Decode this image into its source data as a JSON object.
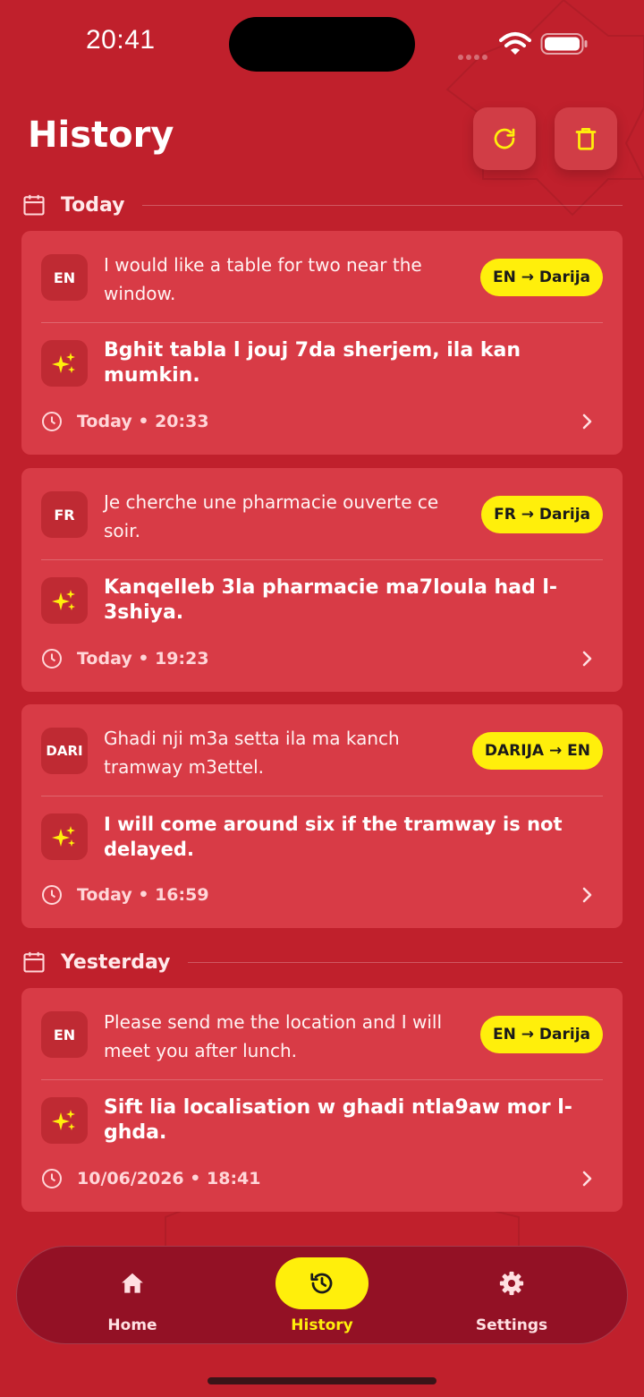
{
  "status_bar": {
    "time": "20:41"
  },
  "header": {
    "title": "History",
    "refresh_icon": "refresh-icon",
    "delete_icon": "trash-icon"
  },
  "sections": [
    {
      "label": "Today"
    },
    {
      "label": "Yesterday"
    }
  ],
  "entries": [
    {
      "src_lang": "EN",
      "source": "I would like a table for two near the window.",
      "direction": "EN → Darija",
      "translation": "Bghit tabla l jouj 7da sherjem, ila kan mumkin.",
      "time": "Today • 20:33"
    },
    {
      "src_lang": "FR",
      "source": "Je cherche une pharmacie ouverte ce soir.",
      "direction": "FR → Darija",
      "translation": "Kanqelleb 3la pharmacie ma7loula had l-3shiya.",
      "time": "Today • 19:23"
    },
    {
      "src_lang": "DARI",
      "source": "Ghadi nji m3a setta ila ma kanch tramway m3ettel.",
      "direction": "DARIJA → EN",
      "translation": "I will come around six if the tramway is not delayed.",
      "time": "Today • 16:59"
    },
    {
      "src_lang": "EN",
      "source": "Please send me the location and I will meet you after lunch.",
      "direction": "EN → Darija",
      "translation": "Sift lia localisation w ghadi ntla9aw mor l-ghda.",
      "time": "10/06/2026 • 18:41"
    }
  ],
  "nav": [
    {
      "label": "Home",
      "icon": "home-icon"
    },
    {
      "label": "History",
      "icon": "history-icon"
    },
    {
      "label": "Settings",
      "icon": "gear-icon"
    }
  ],
  "colors": {
    "background": "#c0202c",
    "card": "#d83b46",
    "accent": "#ffef0b",
    "nav": "#931125"
  }
}
